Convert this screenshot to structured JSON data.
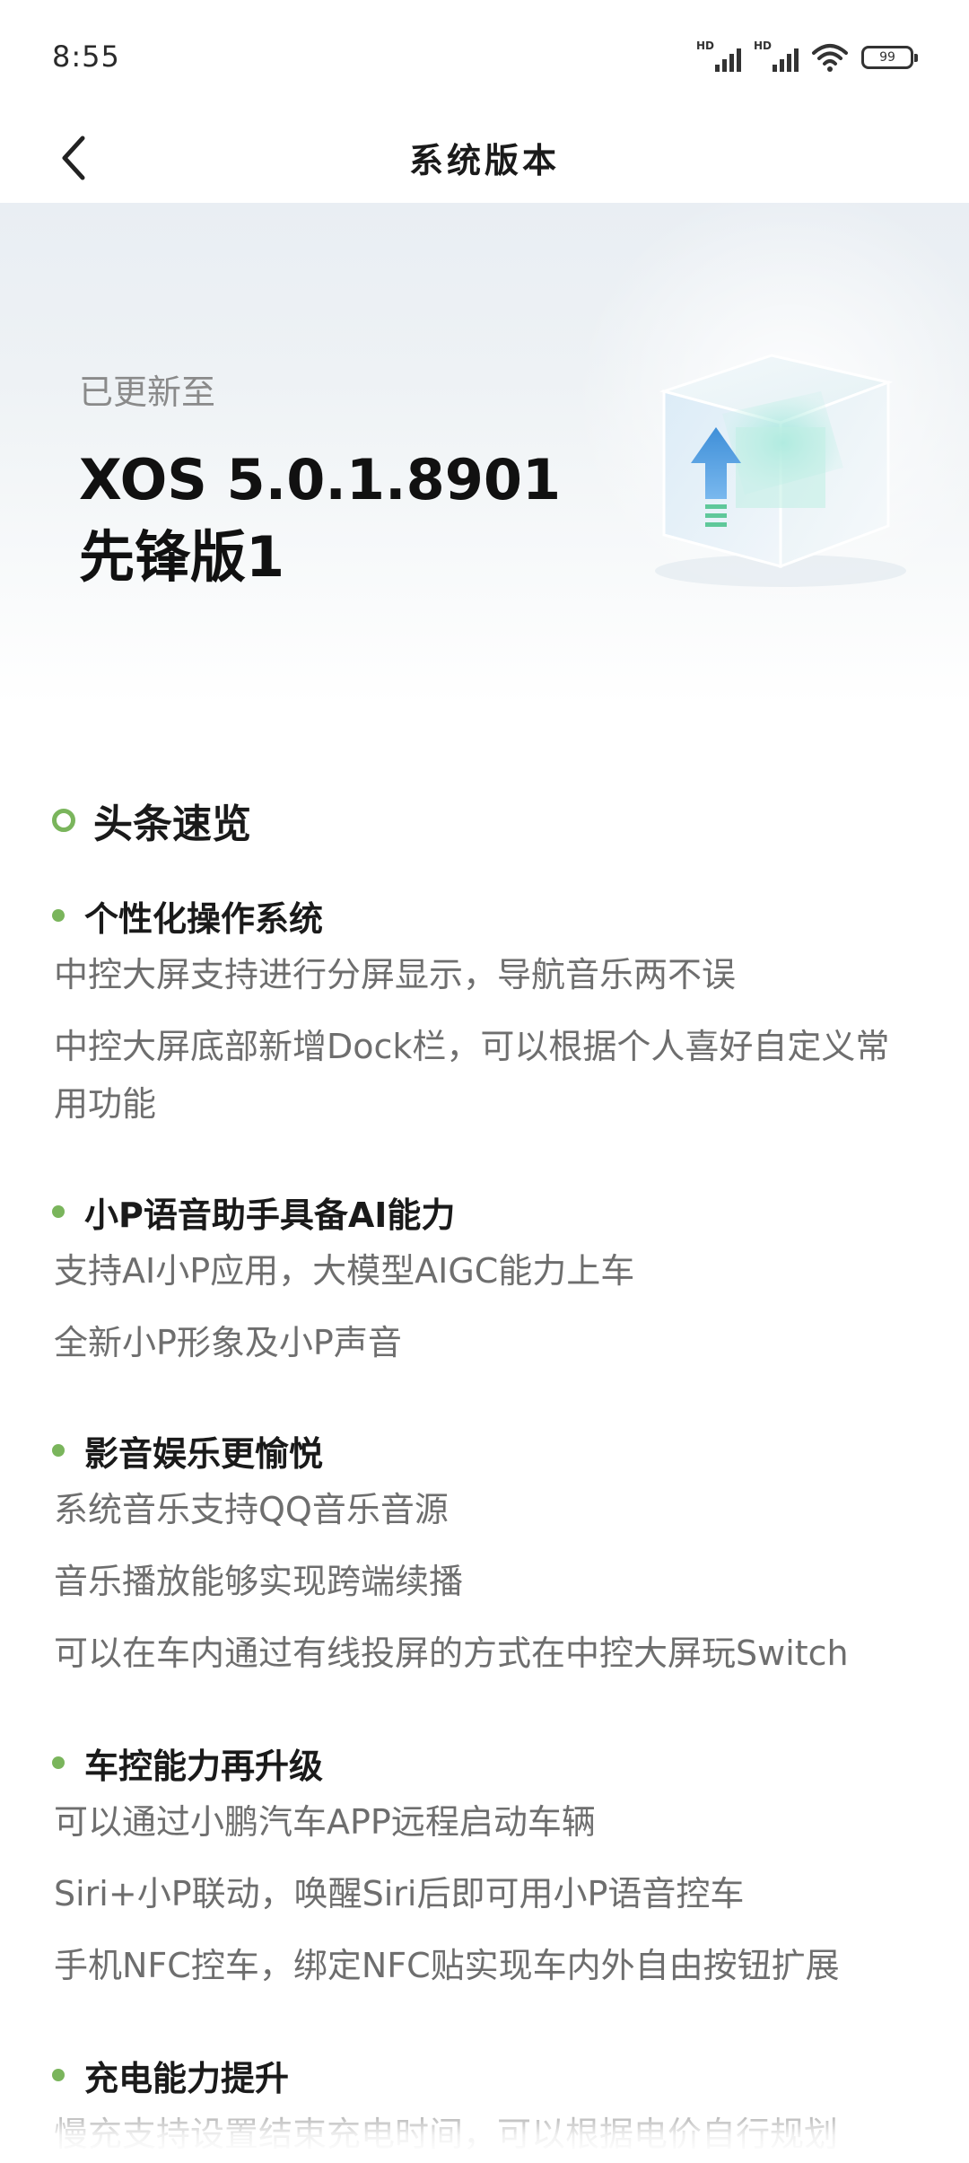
{
  "status_bar": {
    "time": "8:55",
    "signal1_label": "HD",
    "signal2_label": "HD",
    "battery": "99"
  },
  "header": {
    "title": "系统版本",
    "back_icon": "chevron-left-icon"
  },
  "hero": {
    "subtitle": "已更新至",
    "version_line1": "XOS 5.0.1.8901",
    "version_line2": "先锋版1",
    "illustration": "update-cube-icon",
    "accent_color": "#5aa6e6"
  },
  "section": {
    "title": "头条速览",
    "accent_color": "#7ab55c"
  },
  "features": [
    {
      "title": "个性化操作系统",
      "lines": [
        "中控大屏支持进行分屏显示，导航音乐两不误",
        "中控大屏底部新增Dock栏，可以根据个人喜好自定义常用功能"
      ]
    },
    {
      "title": "小P语音助手具备AI能力",
      "lines": [
        "支持AI小P应用，大模型AIGC能力上车",
        "全新小P形象及小P声音"
      ]
    },
    {
      "title": "影音娱乐更愉悦",
      "lines": [
        "系统音乐支持QQ音乐音源",
        "音乐播放能够实现跨端续播",
        "可以在车内通过有线投屏的方式在中控大屏玩Switch"
      ]
    },
    {
      "title": "车控能力再升级",
      "lines": [
        "可以通过小鹏汽车APP远程启动车辆",
        "Siri+小P联动，唤醒Siri后即可用小P语音控车",
        "手机NFC控车，绑定NFC贴实现车内外自由按钮扩展"
      ]
    },
    {
      "title": "充电能力提升",
      "lines": [
        "慢充支持设置结束充电时间，可以根据电价自行规划"
      ]
    }
  ]
}
